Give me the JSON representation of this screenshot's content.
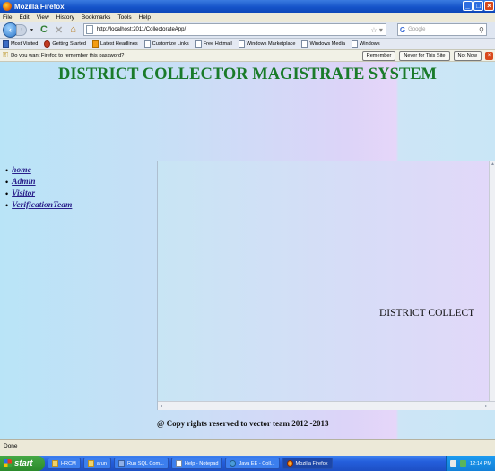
{
  "window": {
    "title": "Mozilla Firefox"
  },
  "menu": [
    "File",
    "Edit",
    "View",
    "History",
    "Bookmarks",
    "Tools",
    "Help"
  ],
  "nav": {
    "url": "http://localhost:2011/CollectorateApp/",
    "search_placeholder": "Google"
  },
  "bookmarks": [
    "Most Visited",
    "Getting Started",
    "Latest Headlines",
    "Customize Links",
    "Free Hotmail",
    "Windows Marketplace",
    "Windows Media",
    "Windows"
  ],
  "password_bar": {
    "message": "Do you want Firefox to remember this password?",
    "remember": "Remember",
    "never": "Never for This Site",
    "not_now": "Not Now"
  },
  "page": {
    "heading": "DISTRICT COLLECTOR MAGISTRATE SYSTEM",
    "nav_links": [
      "home",
      "Admin",
      "Visitor",
      "VerificationTeam"
    ],
    "marquee": "DISTRICT COLLECT",
    "copyright": "@ Copy rights reserved to vector team 2012 -2013"
  },
  "status": {
    "text": "Done"
  },
  "taskbar": {
    "start": "start",
    "tasks": [
      "HRCM",
      "arun",
      "Run SQL Com...",
      "Help - Notepad",
      "Java EE - Coll...",
      "Mozilla Firefox"
    ],
    "clock": "12:14 PM"
  },
  "colors": {
    "heading": "#1a7b2a",
    "link": "#2a1f8a",
    "titlebar": "#1452c8"
  }
}
